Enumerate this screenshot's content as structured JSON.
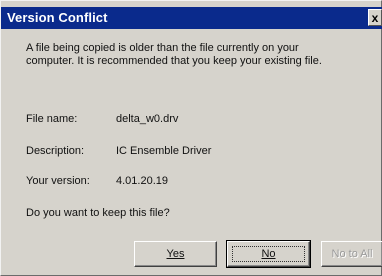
{
  "dialog": {
    "title": "Version Conflict",
    "close_glyph": "x",
    "message_line1": "A file being copied is older than the file currently on your",
    "message_line2": "computer. It is recommended that you keep your existing file.",
    "fields": [
      {
        "label": "File name:",
        "value": "delta_w0.drv"
      },
      {
        "label": "Description:",
        "value": "IC Ensemble Driver"
      },
      {
        "label": "Your version:",
        "value": "4.01.20.19"
      }
    ],
    "question": "Do you want to keep this file?",
    "buttons": {
      "yes": "Yes",
      "no": "No",
      "no_to_all": "No to All"
    }
  }
}
